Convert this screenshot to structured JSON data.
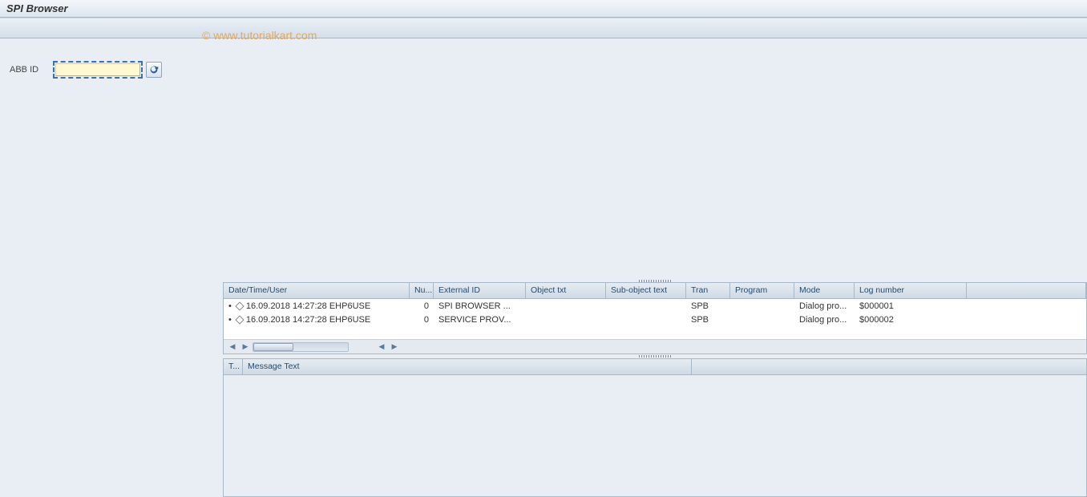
{
  "window": {
    "title": "SPI Browser"
  },
  "watermark": "© www.tutorialkart.com",
  "form": {
    "abb_label": "ABB ID",
    "abb_value": "",
    "refresh_icon": "refresh-icon"
  },
  "log_grid": {
    "columns": {
      "datetime": "Date/Time/User",
      "num": "Nu...",
      "ext": "External ID",
      "obj": "Object txt",
      "sub": "Sub-object text",
      "tran": "Tran",
      "prog": "Program",
      "mode": "Mode",
      "lognum": "Log number"
    },
    "rows": [
      {
        "datetime": "16.09.2018  14:27:28  EHP6USE",
        "num": "0",
        "ext": "SPI BROWSER ...",
        "obj": "",
        "sub": "",
        "tran": "SPB",
        "prog": "",
        "mode": "Dialog pro...",
        "lognum": "$000001"
      },
      {
        "datetime": "16.09.2018  14:27:28  EHP6USE",
        "num": "0",
        "ext": "SERVICE PROV...",
        "obj": "",
        "sub": "",
        "tran": "SPB",
        "prog": "",
        "mode": "Dialog pro...",
        "lognum": "$000002"
      }
    ]
  },
  "msg_grid": {
    "columns": {
      "type": "T...",
      "text": "Message Text"
    }
  }
}
